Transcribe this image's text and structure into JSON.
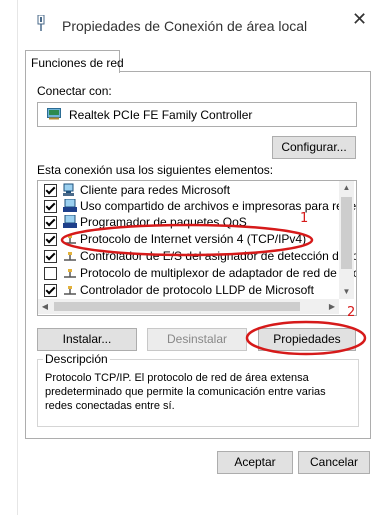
{
  "window": {
    "title": "Propiedades de Conexión de área local",
    "close_glyph": "✕"
  },
  "tab": {
    "label": "Funciones de red"
  },
  "connect": {
    "label": "Conectar con:",
    "adapter": "Realtek PCIe FE Family Controller",
    "configure_button": "Configurar..."
  },
  "items_label": "Esta conexión usa los siguientes elementos:",
  "items": [
    {
      "label": "Cliente para redes Microsoft",
      "checked": true,
      "icon": "network-client-icon"
    },
    {
      "label": "Uso compartido de archivos e impresoras para redes M",
      "checked": true,
      "icon": "network-share-icon"
    },
    {
      "label": "Programador de paquetes QoS",
      "checked": true,
      "icon": "network-service-icon"
    },
    {
      "label": "Protocolo de Internet versión 4 (TCP/IPv4)",
      "checked": true,
      "icon": "protocol-icon"
    },
    {
      "label": "Controlador de E/S del asignador de detección de topo",
      "checked": true,
      "icon": "protocol-icon"
    },
    {
      "label": "Protocolo de multiplexor de adaptador de red de Micros",
      "checked": false,
      "icon": "protocol-icon"
    },
    {
      "label": "Controlador de protocolo LLDP de Microsoft",
      "checked": true,
      "icon": "protocol-icon"
    }
  ],
  "buttons": {
    "install": "Instalar...",
    "uninstall": "Desinstalar",
    "properties": "Propiedades",
    "accept": "Aceptar",
    "cancel": "Cancelar"
  },
  "description": {
    "legend": "Descripción",
    "text": "Protocolo TCP/IP. El protocolo de red de área extensa predeterminado que permite la comunicación entre varias redes conectadas entre sí."
  },
  "annotations": {
    "marker_1": "1",
    "marker_2": "2",
    "color": "#d61a1a"
  }
}
